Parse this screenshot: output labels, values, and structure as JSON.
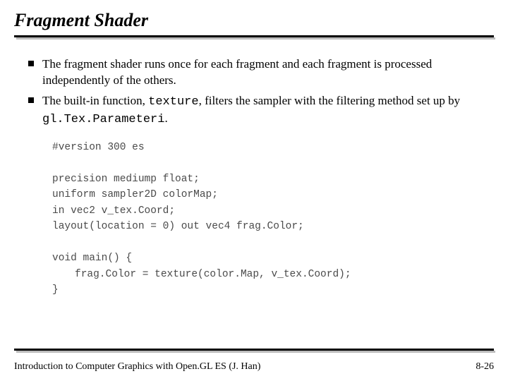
{
  "title": "Fragment Shader",
  "bullets": [
    {
      "pre": "The fragment shader runs once for each fragment and each fragment is processed independently of the others."
    },
    {
      "pre": "The built-in function, ",
      "code1": "texture",
      "mid": ", filters the sampler with the filtering method set up by ",
      "code2": "gl.Tex.Parameteri",
      "post": "."
    }
  ],
  "code": {
    "l1": "#version 300 es",
    "l2": "",
    "l3": "precision mediump float;",
    "l4": "uniform sampler2D colorMap;",
    "l5": "in vec2 v_tex.Coord;",
    "l6": "layout(location = 0) out vec4 frag.Color;",
    "l7": "",
    "l8": "void main() {",
    "l9": "frag.Color = texture(color.Map, v_tex.Coord);",
    "l10": "}"
  },
  "footer": {
    "left": "Introduction to Computer Graphics with Open.GL ES (J. Han)",
    "right": "8-26"
  }
}
